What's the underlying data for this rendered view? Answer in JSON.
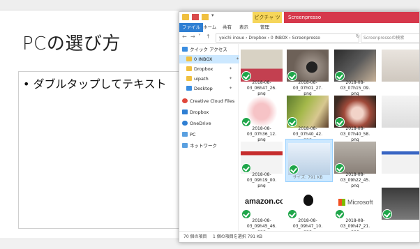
{
  "slide": {
    "title": "PCの選び方",
    "bullet": "• ダブルタップしてテキスト"
  },
  "explorer": {
    "window_title": "Screenpresso",
    "context_tab": "ピクチャ ツール",
    "ribbon_tabs": [
      "ファイル",
      "ホーム",
      "共有",
      "表示",
      "管理"
    ],
    "address_path": "yoichi inoue › Dropbox › 0 INBOX › Screenpresso",
    "search_placeholder": "Screenpressoの検索",
    "nav": [
      {
        "label": "クイック アクセス"
      },
      {
        "label": "0 INBOX"
      },
      {
        "label": "Dropbox"
      },
      {
        "label": "uipath"
      },
      {
        "label": "Desktop"
      },
      {
        "label": "Creative Cloud Files"
      },
      {
        "label": "Dropbox"
      },
      {
        "label": "OneDrive"
      },
      {
        "label": "PC"
      },
      {
        "label": "ネットワーク"
      }
    ],
    "files": [
      {
        "name": "2018-08-03_06h47_26.png",
        "line1": "2018-08-03_06h47_26.",
        "line2": "png"
      },
      {
        "name": "2018-08-03_07h01_27.png",
        "line1": "2018-08-03_07h01_27.",
        "line2": "png"
      },
      {
        "name": "2018-08-03_07h15_09.png",
        "line1": "2018-08-03_07h15_09.",
        "line2": "png"
      },
      {
        "name": "2018-08-03_07h36_12.png",
        "line1": "2018-08-03_07h36_12.",
        "line2": "png"
      },
      {
        "name": "2018-08-03_07h40_42.png",
        "line1": "2018-08-03_07h40_42.",
        "line2": "png"
      },
      {
        "name": "2018-08-03_07h40_58.png",
        "line1": "2018-08-03_07h40_58.",
        "line2": "png"
      },
      {
        "name": "2018-08-03_09h19_00.png",
        "line1": "2018-08-03_09h19_00.",
        "line2": "png"
      },
      {
        "name": "2018-08-03_09h22_45.png",
        "line1": "2018-08-03_09h22_45.",
        "line2": "png"
      },
      {
        "name": "2018-08-03_09h45_46.png",
        "line1": "2018-08-03_09h45_46.",
        "line2": "png"
      },
      {
        "name": "2018-08-03_09h47_10.png",
        "line1": "2018-08-03_09h47_10.",
        "line2": "png"
      },
      {
        "name": "2018-08-03_09h47_21.png",
        "line1": "2018-08-03_09h47_21.",
        "line2": "png"
      }
    ],
    "selected_tooltip": "サイズ: 791 KB",
    "thumb_logos": {
      "amazon": "amazon.com",
      "microsoft": "Microsoft"
    },
    "status_count": "70 個の項目",
    "status_selected": "1 個の項目を選択 791 KB",
    "colors": {
      "title_red": "#d6384b",
      "check_green": "#1fa64a",
      "file_blue": "#2f7fd3",
      "selection": "#cce8ff"
    }
  }
}
